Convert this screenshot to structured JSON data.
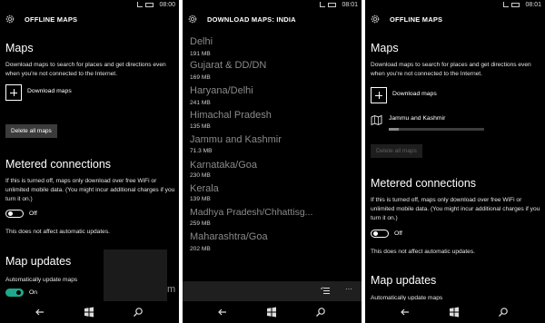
{
  "colors": {
    "background": "#000000",
    "accent_toggle": "#1fa88a",
    "button_bg": "#3b3b3b",
    "appbar_bg": "#1f1f1f"
  },
  "screen1": {
    "status_time": "08:00",
    "header_title": "OFFLINE MAPS",
    "maps_heading": "Maps",
    "maps_description": "Download maps to search for places and get directions even when you're not connected to the Internet.",
    "download_maps_label": "Download maps",
    "delete_all_label": "Delete all maps",
    "metered_heading": "Metered connections",
    "metered_description": "If this is turned off, maps only download over free WiFi or unlimited mobile data. (You might incur additional charges if you turn it on.)",
    "metered_toggle_state": "Off",
    "auto_updates_note": "This does not affect automatic updates.",
    "map_updates_heading": "Map updates",
    "auto_update_label": "Automatically update maps",
    "auto_update_toggle_state": "On",
    "trailing_text": "m"
  },
  "screen2": {
    "status_time": "08:01",
    "header_title": "DOWNLOAD MAPS: INDIA",
    "regions": [
      {
        "name": "Delhi",
        "size": "191 MB"
      },
      {
        "name": "Gujarat & DD/DN",
        "size": "169 MB"
      },
      {
        "name": "Haryana/Delhi",
        "size": "241 MB"
      },
      {
        "name": "Himachal Pradesh",
        "size": "135 MB"
      },
      {
        "name": "Jammu and Kashmir",
        "size": "71.3 MB"
      },
      {
        "name": "Karnataka/Goa",
        "size": "230 MB"
      },
      {
        "name": "Kerala",
        "size": "139 MB"
      },
      {
        "name": "Madhya Pradesh/Chhattisg...",
        "size": "259 MB"
      },
      {
        "name": "Maharashtra/Goa",
        "size": "202 MB"
      }
    ],
    "more_label": "···"
  },
  "screen3": {
    "status_time": "08:01",
    "header_title": "OFFLINE MAPS",
    "maps_heading": "Maps",
    "maps_description": "Download maps to search for places and get directions even when you're not connected to the Internet.",
    "download_maps_label": "Download maps",
    "downloading_region": "Jammu and Kashmir",
    "download_progress_percent": 10,
    "delete_all_label": "Delete all maps",
    "metered_heading": "Metered connections",
    "metered_description": "If this is turned off, maps only download over free WiFi or unlimited mobile data. (You might incur additional charges if you turn it on.)",
    "metered_toggle_state": "Off",
    "auto_updates_note": "This does not affect automatic updates.",
    "map_updates_heading": "Map updates",
    "auto_update_label": "Automatically update maps"
  }
}
